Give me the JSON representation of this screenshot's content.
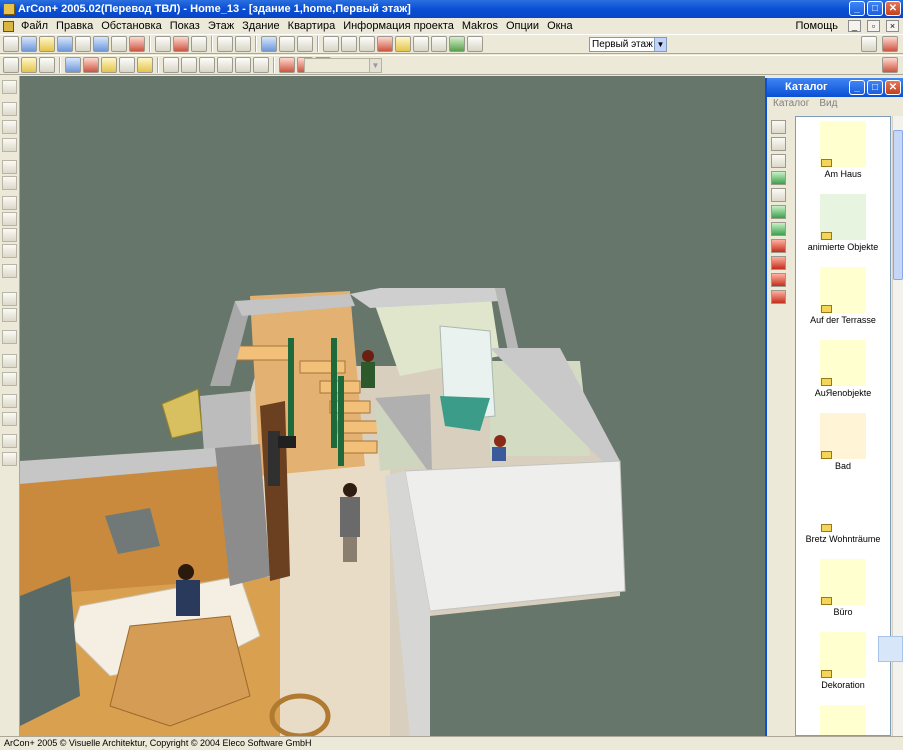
{
  "window": {
    "title": "ArCon+ 2005.02(Перевод ТВЛ) - Home_13 - [здание 1,home,Первый этаж]",
    "min": "_",
    "max": "□",
    "close": "✕"
  },
  "menu": {
    "items": [
      "Файл",
      "Правка",
      "Обстановка",
      "Показ",
      "Этаж",
      "Здание",
      "Квартира",
      "Информация проекта",
      "Makros",
      "Опции",
      "Окна"
    ],
    "help": "Помощь"
  },
  "toolbar": {
    "floor_select": "Первый этаж"
  },
  "catalog": {
    "title": "Каталог",
    "menu": [
      "Каталог",
      "Вид"
    ],
    "items": [
      {
        "label": "Am Haus",
        "icon": "garden-furniture-icon"
      },
      {
        "label": "animierte Objekte",
        "icon": "figure-icon"
      },
      {
        "label": "Auf der Terrasse",
        "icon": "pavilion-icon"
      },
      {
        "label": "AuЯenobjekte",
        "icon": "fence-icon"
      },
      {
        "label": "Bad",
        "icon": "sink-icon"
      },
      {
        "label": "Bretz Wohnträume",
        "icon": "bretz-logo-icon"
      },
      {
        "label": "Büro",
        "icon": "desk-icon"
      },
      {
        "label": "Dekoration",
        "icon": "vase-icon"
      }
    ]
  },
  "status": {
    "text": "ArCon+ 2005 © Visuelle Architektur, Copyright © 2004 Eleco Software GmbH"
  }
}
